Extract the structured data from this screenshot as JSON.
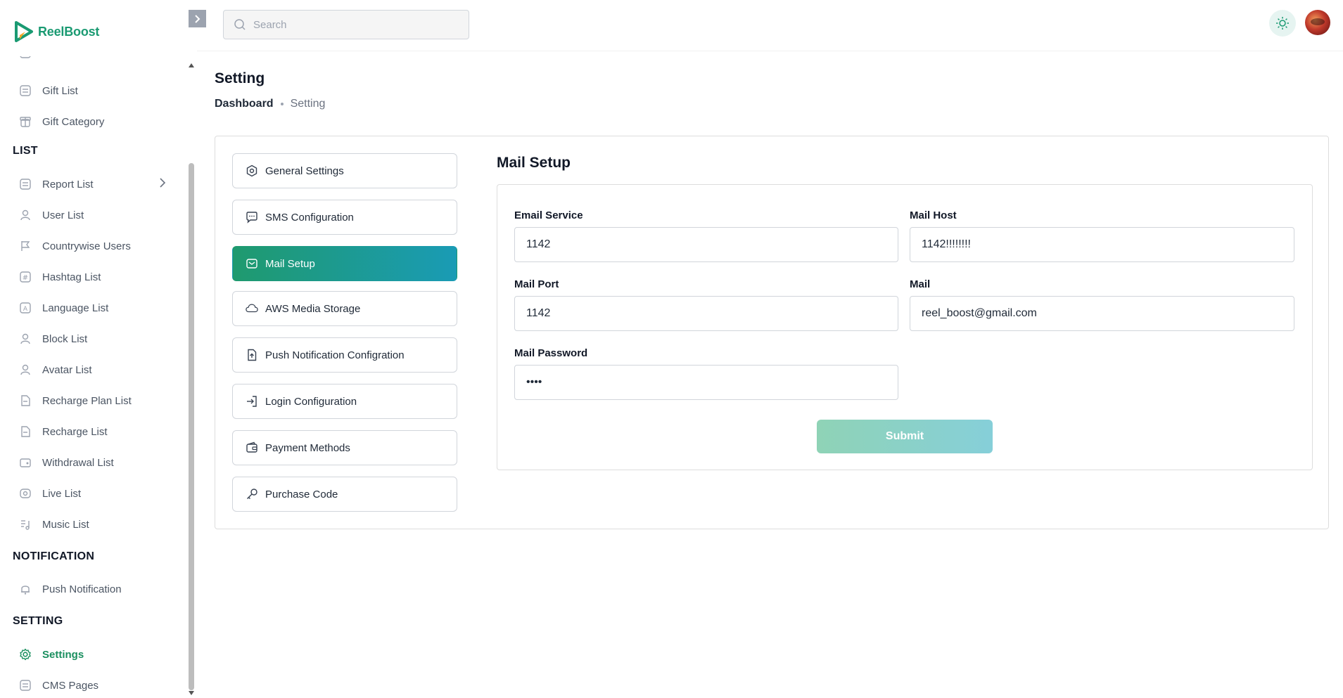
{
  "app": {
    "name": "ReelBoost"
  },
  "search": {
    "placeholder": "Search"
  },
  "sidebar": {
    "items_top": [
      {
        "label": "Gift List",
        "icon": "list-icon"
      },
      {
        "label": "Gift Category",
        "icon": "gift-box-icon"
      }
    ],
    "section_list": "LIST",
    "list_items": [
      {
        "label": "Report List",
        "icon": "list-icon"
      },
      {
        "label": "User List",
        "icon": "user-icon"
      },
      {
        "label": "Countrywise Users",
        "icon": "flag-icon"
      },
      {
        "label": "Hashtag List",
        "icon": "hashtag-icon"
      },
      {
        "label": "Language List",
        "icon": "language-icon"
      },
      {
        "label": "Block List",
        "icon": "user-icon"
      },
      {
        "label": "Avatar List",
        "icon": "user-icon"
      },
      {
        "label": "Recharge Plan List",
        "icon": "document-icon"
      },
      {
        "label": "Recharge List",
        "icon": "document-icon"
      },
      {
        "label": "Withdrawal List",
        "icon": "wallet-icon"
      },
      {
        "label": "Live List",
        "icon": "live-icon"
      },
      {
        "label": "Music List",
        "icon": "music-icon"
      }
    ],
    "section_notification": "NOTIFICATION",
    "notification_items": [
      {
        "label": "Push Notification",
        "icon": "bell-icon"
      }
    ],
    "section_setting": "SETTING",
    "setting_items": [
      {
        "label": "Settings",
        "icon": "gear-icon"
      },
      {
        "label": "CMS Pages",
        "icon": "list-icon"
      }
    ]
  },
  "page": {
    "title": "Setting",
    "breadcrumb": {
      "home": "Dashboard",
      "current": "Setting"
    }
  },
  "settings_menu": [
    {
      "label": "General Settings",
      "icon": "hexagon-gear-icon"
    },
    {
      "label": "SMS Configuration",
      "icon": "chat-bubble-icon"
    },
    {
      "label": "Mail Setup",
      "icon": "mail-icon"
    },
    {
      "label": "AWS Media Storage",
      "icon": "cloud-icon"
    },
    {
      "label": "Push Notification Configration",
      "icon": "file-upload-icon"
    },
    {
      "label": "Login Configuration",
      "icon": "login-icon"
    },
    {
      "label": "Payment Methods",
      "icon": "wallet-icon"
    },
    {
      "label": "Purchase Code",
      "icon": "key-icon"
    }
  ],
  "mail_setup": {
    "heading": "Mail Setup",
    "email_service": {
      "label": "Email Service",
      "value": "1142"
    },
    "mail_host": {
      "label": "Mail Host",
      "value": "1142!!!!!!!!"
    },
    "mail_port": {
      "label": "Mail Port",
      "value": "1142"
    },
    "mail": {
      "label": "Mail",
      "value": "reel_boost@gmail.com"
    },
    "mail_password": {
      "label": "Mail Password",
      "value": "1142"
    },
    "submit_label": "Submit"
  },
  "colors": {
    "brand_green": "#1a9a72",
    "active_gradient_start": "#1f9a6e",
    "active_gradient_end": "#1a9bb5",
    "submit_gradient_start": "#8fd3b6",
    "submit_gradient_end": "#86cfd9"
  }
}
